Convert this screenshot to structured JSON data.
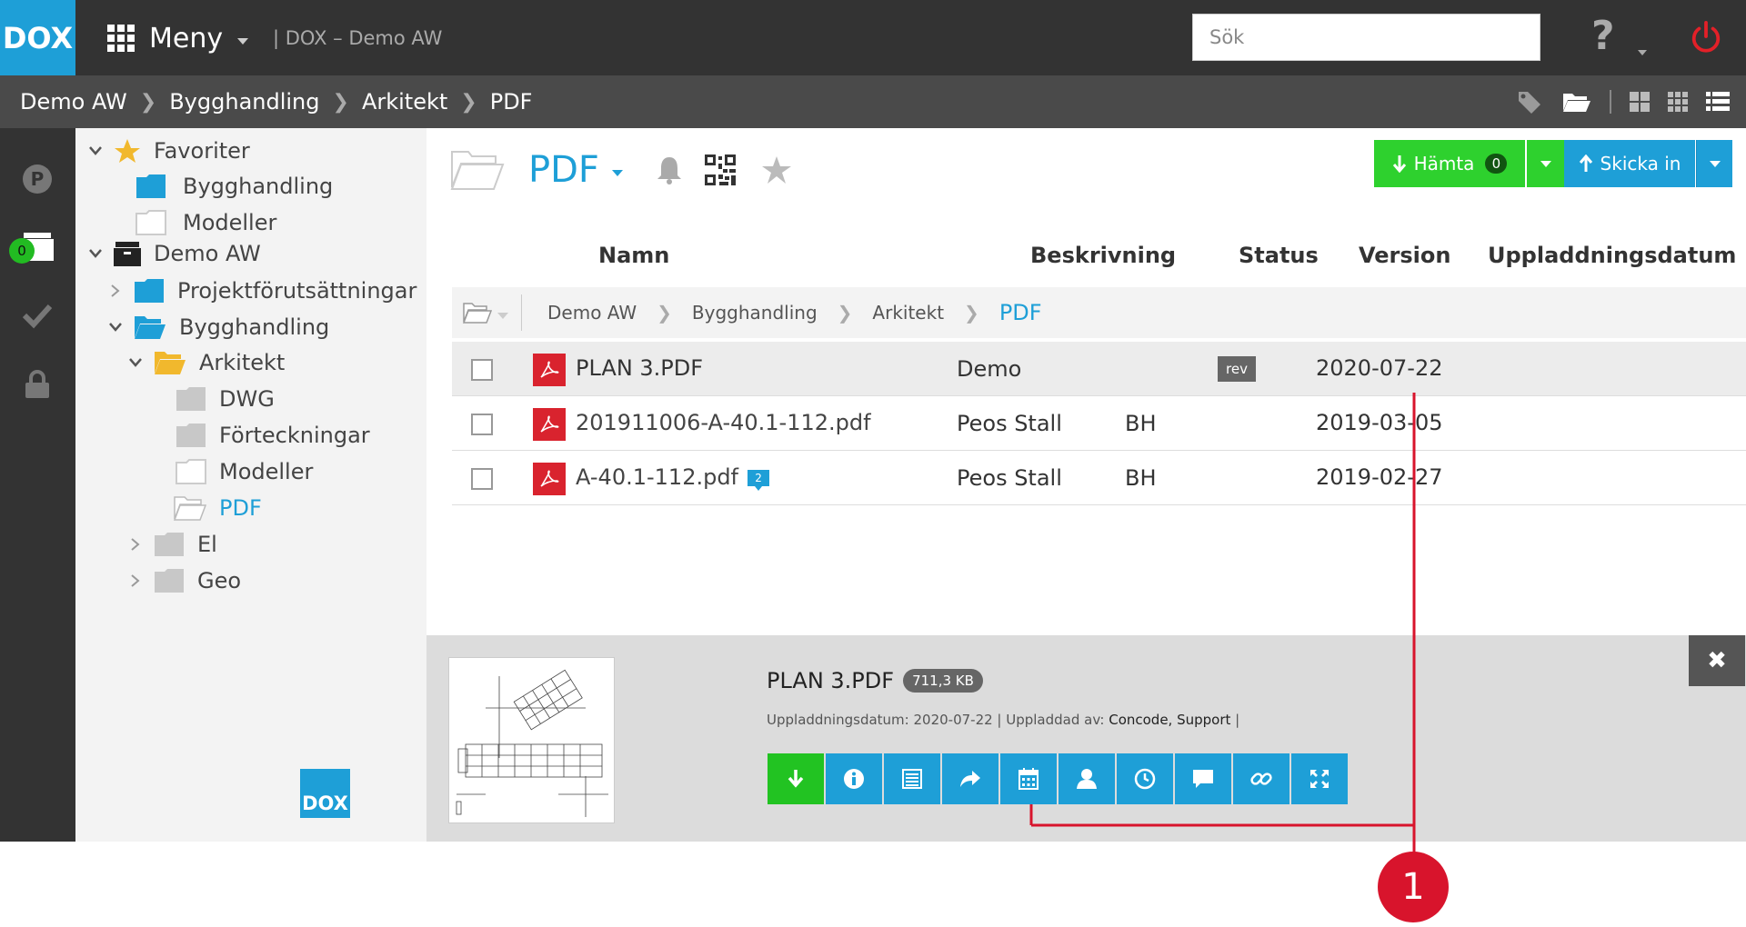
{
  "app": {
    "logo": "DOX",
    "menu_label": "Meny",
    "app_name": "| DOX – Demo AW",
    "search_placeholder": "Sök",
    "help_label": "?"
  },
  "breadcrumb": [
    "Demo AW",
    "Bygghandling",
    "Arkitekt",
    "PDF"
  ],
  "rail": {
    "badge_count": "0"
  },
  "tree": {
    "favorites_label": "Favoriter",
    "favorites": [
      "Bygghandling",
      "Modeller"
    ],
    "project_label": "Demo AW",
    "items": [
      "Projektförutsättningar",
      "Bygghandling",
      "Arkitekt",
      "DWG",
      "Förteckningar",
      "Modeller",
      "PDF",
      "El",
      "Geo"
    ],
    "footer_logo": "DOX"
  },
  "folder": {
    "title": "PDF"
  },
  "buttons": {
    "hamta_label": "Hämta",
    "hamta_count": "0",
    "skicka_label": "Skicka in"
  },
  "columns": {
    "name": "Namn",
    "description": "Beskrivning",
    "status": "Status",
    "version": "Version",
    "date": "Uppladdningsdatum"
  },
  "path": [
    "Demo AW",
    "Bygghandling",
    "Arkitekt",
    "PDF"
  ],
  "files": [
    {
      "name": "PLAN 3.PDF",
      "description": "Demo",
      "status": "",
      "version": "rev",
      "date": "2020-07-22",
      "comments": ""
    },
    {
      "name": "201911006-A-40.1-112.pdf",
      "description": "Peos Stall",
      "status": "BH",
      "version": "",
      "date": "2019-03-05",
      "comments": ""
    },
    {
      "name": "A-40.1-112.pdf",
      "description": "Peos Stall",
      "status": "BH",
      "version": "",
      "date": "2019-02-27",
      "comments": "2"
    }
  ],
  "preview": {
    "title": "PLAN 3.PDF",
    "size": "711,3 KB",
    "meta_prefix": "Uppladdningsdatum: 2020-07-22 | Uppladdad av: ",
    "uploader": "Concode, Support",
    "meta_suffix": " |",
    "actions": [
      "download-icon",
      "info-icon",
      "list-icon",
      "share-icon",
      "calendar-icon",
      "user-icon",
      "clock-icon",
      "comment-icon",
      "link-icon",
      "expand-icon"
    ],
    "close_label": "✖"
  },
  "annotation": {
    "number": "1",
    "color": "#d8142c"
  },
  "colors": {
    "accent": "#1e9fd7",
    "green": "#2ed12e",
    "topbar": "#333333",
    "pdf_red": "#d9232e"
  }
}
